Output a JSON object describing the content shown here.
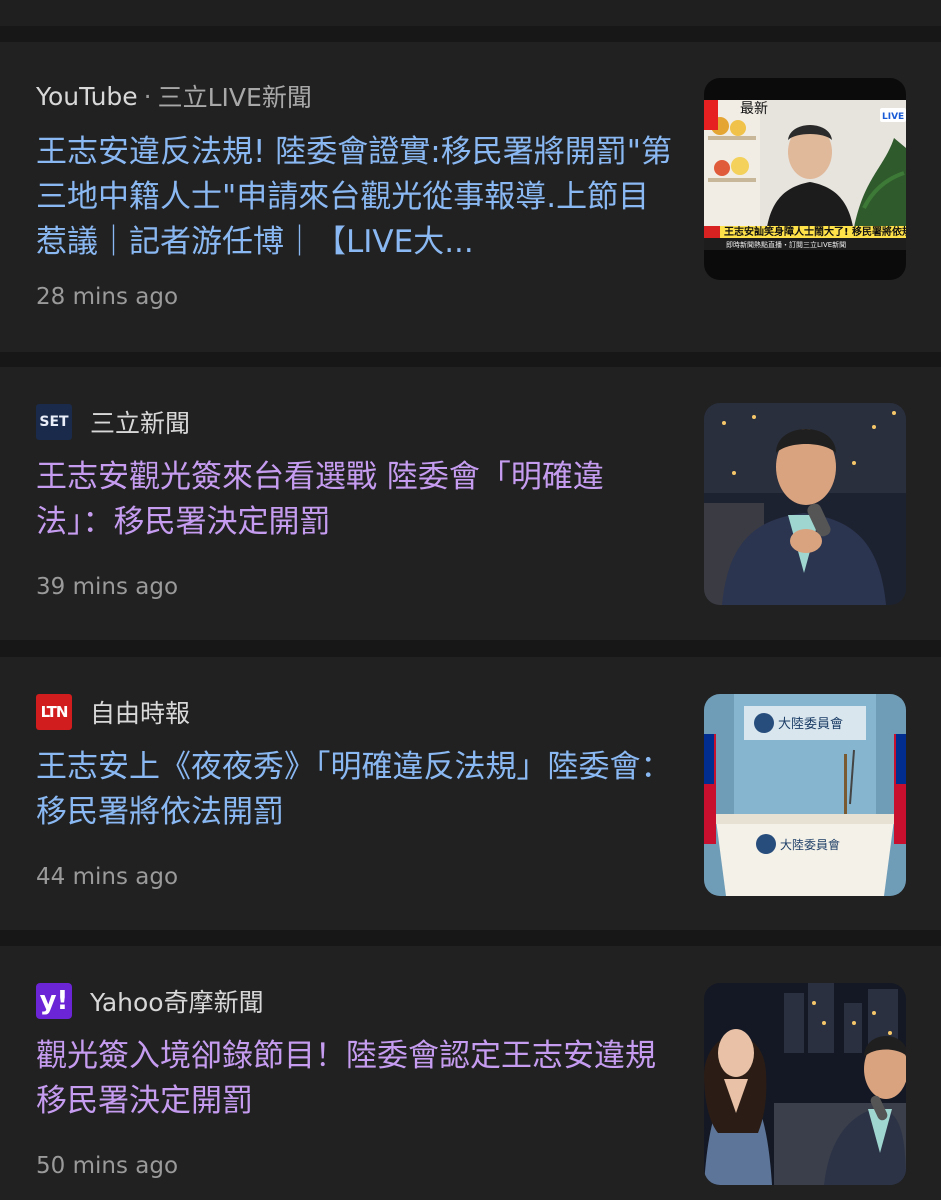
{
  "articles": [
    {
      "source": "YouTube",
      "separator": "·",
      "channel": "三立LIVE新聞",
      "headline": "王志安違反法規! 陸委會證實:移民署將開罰\"第三地中籍人士\"申請來台觀光從事報導.上節目惹議｜記者游任博｜【LIVE大...",
      "time": "28 mins ago",
      "visited": false,
      "thumbnail": {
        "tag": "LIVE",
        "banner_left": "最新",
        "caption": "王志安訕笑身障人士鬧大了! 移民署將依規",
        "ticker": "即時新聞熱點直播・訂閱三立LIVE新聞"
      }
    },
    {
      "source": "三立新聞",
      "logo": "SET",
      "headline": "王志安觀光簽來台看選戰 陸委會「明確違法」：移民署決定開罰",
      "time": "39 mins ago",
      "visited": true
    },
    {
      "source": "自由時報",
      "logo": "LTN",
      "headline": "王志安上《夜夜秀》「明確違反法規」陸委會：移民署將依法開罰",
      "time": "44 mins ago",
      "visited": false,
      "thumbnail": {
        "wall_sign": "大陸委員會",
        "podium_sign": "大陸委員會"
      }
    },
    {
      "source": "Yahoo奇摩新聞",
      "logo": "y!",
      "headline": "觀光簽入境卻錄節目！陸委會認定王志安違規移民署決定開罰",
      "time": "50 mins ago",
      "visited": true
    }
  ],
  "colors": {
    "background": "#171717",
    "card": "#212121",
    "link_unvisited": "#8ab8f2",
    "link_visited": "#c59cf0",
    "meta": "#9a9a9a"
  }
}
